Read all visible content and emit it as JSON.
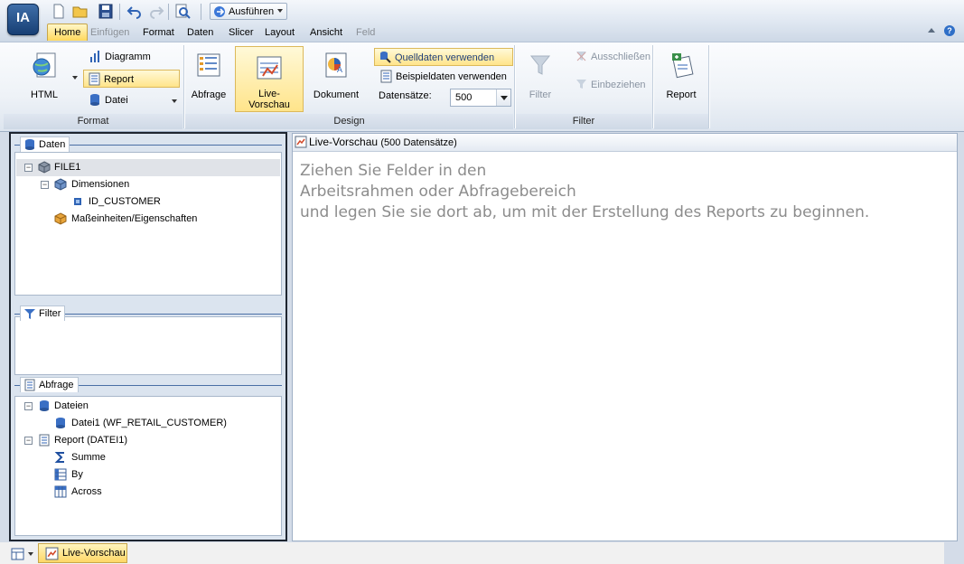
{
  "app": {
    "logo_text": "IA"
  },
  "quick_access": {
    "run_label": "Ausführen"
  },
  "menu": {
    "tabs": [
      {
        "label": "Home",
        "state": "active"
      },
      {
        "label": "Einfügen",
        "state": "disabled"
      },
      {
        "label": "Format",
        "state": "normal"
      },
      {
        "label": "Daten",
        "state": "normal"
      },
      {
        "label": "Slicer",
        "state": "normal"
      },
      {
        "label": "Layout",
        "state": "normal"
      },
      {
        "label": "Ansicht",
        "state": "normal"
      },
      {
        "label": "Feld",
        "state": "disabled"
      }
    ],
    "help_icon_text": "?"
  },
  "ribbon": {
    "format": {
      "label": "Format",
      "html_label": "HTML",
      "diagramm_label": "Diagramm",
      "report_label": "Report",
      "datei_label": "Datei"
    },
    "design": {
      "label": "Design",
      "abfrage_label": "Abfrage",
      "live_label_1": "Live-",
      "live_label_2": "Vorschau",
      "dokument_label": "Dokument",
      "quelldaten_label": "Quelldaten verwenden",
      "beispieldaten_label": "Beispieldaten verwenden",
      "records_label": "Datensätze:",
      "records_value": "500"
    },
    "filter": {
      "label": "Filter",
      "filter_label": "Filter",
      "ausschliessen_label": "Ausschließen",
      "einbeziehen_label": "Einbeziehen"
    },
    "report": {
      "report_label": "Report"
    }
  },
  "left_panel": {
    "daten": {
      "title": "Daten",
      "items": [
        {
          "label": "FILE1"
        },
        {
          "label": "Dimensionen"
        },
        {
          "label": "ID_CUSTOMER"
        },
        {
          "label": "Maßeinheiten/Eigenschaften"
        }
      ]
    },
    "filter": {
      "title": "Filter"
    },
    "abfrage": {
      "title": "Abfrage",
      "items": [
        {
          "label": "Dateien"
        },
        {
          "label": "Datei1 (WF_RETAIL_CUSTOMER)"
        },
        {
          "label": "Report (DATEI1)"
        },
        {
          "label": "Summe"
        },
        {
          "label": "By"
        },
        {
          "label": "Across"
        }
      ]
    }
  },
  "preview": {
    "title": "Live-Vorschau",
    "count": "(500 Datensätze)",
    "placeholder_lines": [
      "Ziehen Sie Felder in den",
      "Arbeitsrahmen oder Abfragebereich",
      "und legen Sie sie dort ab, um mit der Erstellung des Reports zu beginnen."
    ]
  },
  "bottom": {
    "tab_label": "Live-Vorschau"
  },
  "colors": {
    "accent": "#ffd85c",
    "panel_border": "#1e2530",
    "placeholder_text": "#8c8c8c"
  }
}
